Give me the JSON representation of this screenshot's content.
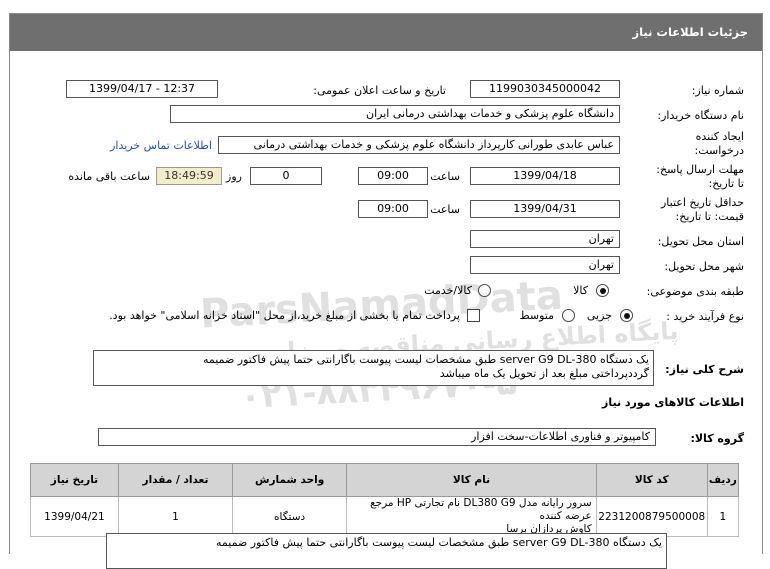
{
  "header": {
    "title": "جزئیات اطلاعات نیاز"
  },
  "fields": {
    "need_number_label": "شماره نیاز:",
    "need_number": "1199030345000042",
    "announce_label": "تاریخ و ساعت اعلان عمومی:",
    "announce_value": "1399/04/17 - 12:37",
    "buyer_label": "نام دستگاه خریدار:",
    "buyer_value": "دانشگاه علوم پزشکی و خدمات بهداشتی درمانی ایران",
    "requester_label_1": "ایجاد کننده",
    "requester_label_2": "درخواست:",
    "requester_value": "عباس عابدی طورانی کارپرداز دانشگاه علوم پزشکی و خدمات بهداشتی درمانی",
    "contact_link": "اطلاعات تماس خریدار",
    "deadline_label_1": "مهلت ارسال پاسخ:",
    "deadline_label_2": "تا تاریخ:",
    "deadline_date": "1399/04/18",
    "time_label": "ساعت",
    "deadline_time": "09:00",
    "days_value": "0",
    "days_label": "روز و",
    "remaining_time": "18:49:59",
    "remaining_label": "ساعت باقی مانده",
    "validity_label_1": "حداقل تاریخ اعتبار",
    "validity_label_2": "قیمت: تا تاریخ:",
    "validity_date": "1399/04/31",
    "validity_time": "09:00",
    "province_label": "استان محل تحویل:",
    "province_value": "تهران",
    "city_label": "شهر محل تحویل:",
    "city_value": "تهران",
    "category_label": "طبقه بندی موضوعی:",
    "category_goods": "کالا",
    "category_goods_service": "کالا/خدمت",
    "process_label": "نوع فرآیند خرید :",
    "process_partial": "جزیی",
    "process_medium": "متوسط",
    "payment_note": "پرداخت تمام یا بخشی از مبلغ خرید،از محل \"اسناد خزانه اسلامی\" خواهد بود."
  },
  "description": {
    "label": "شرح کلی نیاز:",
    "line1": "یک دستگاه server G9 DL-380 طبق مشخصات لیست پیوست باگارانتی حتما پیش فاکتور ضمیمه",
    "line2": "گرددپرداختی مبلغ بعد از تحویل یک ماه میباشد",
    "bottom_preview": "یک دستگاه server G9 DL-380 طبق مشخصات لیست پیوست باگارانتی حتما پیش فاکتور ضمیمه"
  },
  "goods_section": {
    "title": "اطلاعات کالاهای مورد نیاز",
    "group_label": "گروه کالا:",
    "group_value": "کامپیوتر و فناوری اطلاعات-سخت افزار"
  },
  "table": {
    "headers": [
      "ردیف",
      "کد کالا",
      "نام کالا",
      "واحد شمارش",
      "تعداد / مقدار",
      "تاریخ نیاز"
    ],
    "rows": [
      {
        "row": "1",
        "code": "2231200879500008",
        "name_line1": "سرور رایانه مدل DL380 G9 نام تجارتی HP مرجع عرضه کننده",
        "name_line2": "کاوش پردازان برسا",
        "unit": "دستگاه",
        "qty": "1",
        "date": "1399/04/21"
      }
    ]
  },
  "watermark": {
    "brand": "ParsNamadData",
    "line1": "پایگاه اطلاع رسانی مناقصه و مزایده",
    "phone": "۰۲۱-۸۸۳۴۹۶۷۰-۵"
  }
}
